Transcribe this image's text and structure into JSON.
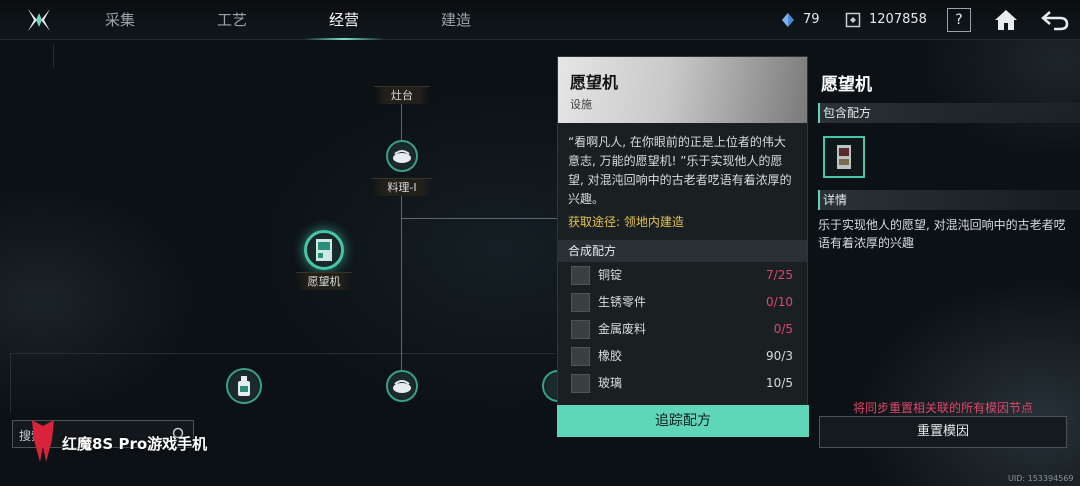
{
  "nav": {
    "tabs": [
      "采集",
      "工艺",
      "经营",
      "建造"
    ],
    "active_tab": "经营"
  },
  "resources": {
    "crystal": "79",
    "coins": "1207858"
  },
  "help_label": "?",
  "tree": {
    "nodes": [
      {
        "label": "灶台",
        "icon": "stove-icon"
      },
      {
        "label": "料理-I",
        "icon": "dish-icon"
      },
      {
        "label": "愿望机",
        "icon": "wishing-machine-icon",
        "selected": true
      },
      {
        "label": "",
        "icon": "bottle-icon"
      },
      {
        "label": "",
        "icon": "dish-icon"
      },
      {
        "label": "",
        "icon": "dish-icon"
      }
    ]
  },
  "card": {
    "title": "愿望机",
    "subtitle": "设施",
    "description": "“看啊凡人, 在你眼前的正是上位者的伟大意志, 万能的愿望机! ”乐于实现他人的愿望, 对混沌回响中的古老者呓语有着浓厚的兴趣。",
    "source": "获取途径: 领地内建造",
    "recipe_header": "合成配方",
    "materials": [
      {
        "name": "铜锭",
        "qty": "7/25",
        "enough": false,
        "icon": "copper-ingot-icon"
      },
      {
        "name": "生锈零件",
        "qty": "0/10",
        "enough": false,
        "icon": "rusty-parts-icon"
      },
      {
        "name": "金属废料",
        "qty": "0/5",
        "enough": false,
        "icon": "metal-scrap-icon"
      },
      {
        "name": "橡胶",
        "qty": "90/3",
        "enough": true,
        "icon": "rubber-icon"
      },
      {
        "name": "玻璃",
        "qty": "10/5",
        "enough": true,
        "icon": "glass-icon"
      }
    ],
    "track_button": "追踪配方"
  },
  "panel": {
    "title": "愿望机",
    "recipes_header": "包含配方",
    "details_header": "详情",
    "details": "乐于实现他人的愿望, 对混沌回响中的古老者呓语有着浓厚的兴趣",
    "warning": "将同步重置相关联的所有模因节点",
    "reset_button": "重置模因",
    "uid": "UID: 153394569"
  },
  "search": {
    "placeholder": "搜索"
  },
  "watermark": {
    "text": "红魔8S Pro游戏手机"
  },
  "colors": {
    "accent": "#5fd6b9",
    "warning": "#e0466c",
    "source": "#e3c254"
  }
}
